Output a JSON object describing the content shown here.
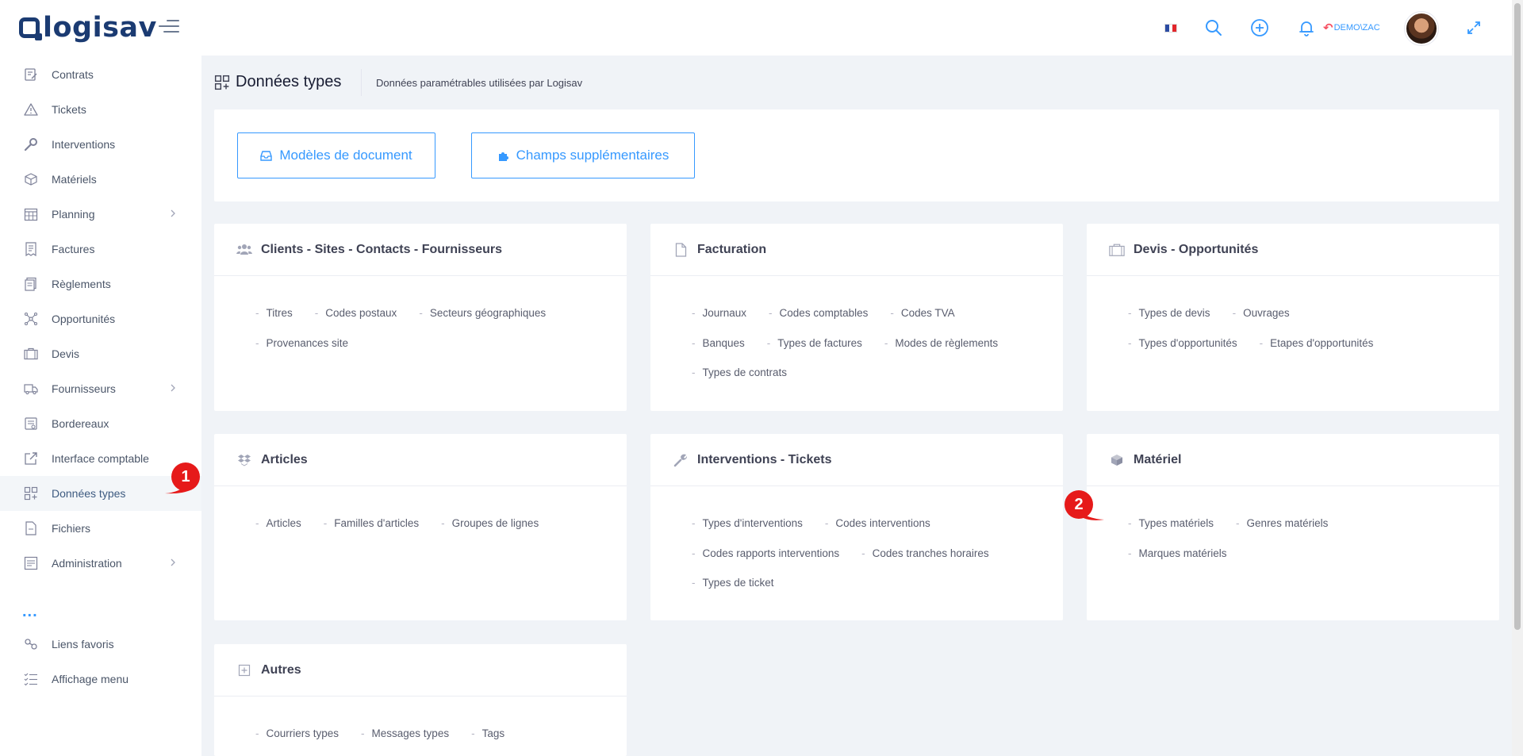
{
  "app": {
    "logo_text": "logisav"
  },
  "topbar": {
    "user_label": "DEMO\\ZAC",
    "icons": [
      "french-flag-icon",
      "search-icon",
      "plus-circle-icon",
      "bell-icon",
      "undo-arrow-icon",
      "avatar",
      "expand-icon"
    ]
  },
  "sidebar": {
    "items": [
      {
        "label": "Contrats",
        "icon": "contract-icon"
      },
      {
        "label": "Tickets",
        "icon": "warning-triangle-icon"
      },
      {
        "label": "Interventions",
        "icon": "wrench-icon"
      },
      {
        "label": "Matériels",
        "icon": "box-icon"
      },
      {
        "label": "Planning",
        "icon": "calendar-icon",
        "has_children": true
      },
      {
        "label": "Factures",
        "icon": "invoice-icon"
      },
      {
        "label": "Règlements",
        "icon": "payments-icon"
      },
      {
        "label": "Opportunités",
        "icon": "network-icon"
      },
      {
        "label": "Devis",
        "icon": "briefcase-icon"
      },
      {
        "label": "Fournisseurs",
        "icon": "truck-icon",
        "has_children": true
      },
      {
        "label": "Bordereaux",
        "icon": "slips-icon"
      },
      {
        "label": "Interface comptable",
        "icon": "external-link-icon"
      },
      {
        "label": "Données types",
        "icon": "grid-plus-icon",
        "active": true
      },
      {
        "label": "Fichiers",
        "icon": "file-icon"
      },
      {
        "label": "Administration",
        "icon": "admin-icon",
        "has_children": true
      }
    ],
    "more_dots": "...",
    "bottom_items": [
      {
        "label": "Liens favoris",
        "icon": "link-icon"
      },
      {
        "label": "Affichage menu",
        "icon": "list-check-icon"
      }
    ]
  },
  "badges": {
    "first": "1",
    "second": "2"
  },
  "subheader": {
    "title": "Données types",
    "description": "Données paramétrables utilisées par Logisav"
  },
  "buttons": {
    "models": "Modèles de document",
    "extra_fields": "Champs supplémentaires"
  },
  "sections": {
    "clients": {
      "title": "Clients - Sites - Contacts - Fournisseurs",
      "rows": [
        [
          "Titres",
          "Codes postaux",
          "Secteurs géographiques"
        ],
        [
          "Provenances site"
        ]
      ]
    },
    "facturation": {
      "title": "Facturation",
      "rows": [
        [
          "Journaux",
          "Codes comptables",
          "Codes TVA"
        ],
        [
          "Banques",
          "Types de factures",
          "Modes de règlements"
        ],
        [
          "Types de contrats"
        ]
      ]
    },
    "devis": {
      "title": "Devis - Opportunités",
      "rows": [
        [
          "Types de devis",
          "Ouvrages"
        ],
        [
          "Types d'opportunités",
          "Etapes d'opportunités"
        ]
      ]
    },
    "articles": {
      "title": "Articles",
      "rows": [
        [
          "Articles",
          "Familles d'articles",
          "Groupes de lignes"
        ]
      ]
    },
    "interventions": {
      "title": "Interventions - Tickets",
      "rows": [
        [
          "Types d'interventions",
          "Codes interventions"
        ],
        [
          "Codes rapports interventions",
          "Codes tranches horaires"
        ],
        [
          "Types de ticket"
        ]
      ]
    },
    "materiel": {
      "title": "Matériel",
      "rows": [
        [
          "Types matériels",
          "Genres matériels"
        ],
        [
          "Marques matériels"
        ]
      ]
    },
    "autres": {
      "title": "Autres",
      "rows": [
        [
          "Courriers types",
          "Messages types",
          "Tags"
        ]
      ]
    }
  },
  "colors": {
    "accent": "#3699ff",
    "brand": "#1b3b72",
    "badge": "#e61a1a"
  }
}
